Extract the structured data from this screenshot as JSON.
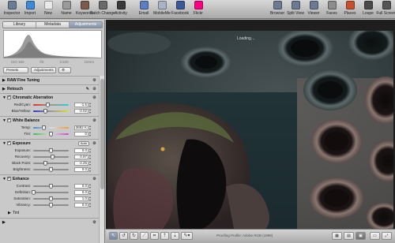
{
  "toolbar": {
    "left": [
      {
        "label": "Inspector",
        "icon": "inspector-icon",
        "color": "#6b7d96"
      },
      {
        "label": "Import",
        "icon": "import-icon",
        "color": "#3e8ad6"
      },
      {
        "label": "New",
        "icon": "new-icon",
        "color": "#e9e9e9"
      },
      {
        "label": "Name",
        "icon": "name-icon",
        "color": "#9a9a9a"
      },
      {
        "label": "Keywords",
        "icon": "keywords-icon",
        "color": "#7d5c4e"
      },
      {
        "label": "Batch Change",
        "icon": "batch-change-icon",
        "color": "#6a6a6a"
      },
      {
        "label": "Activity",
        "icon": "activity-icon",
        "color": "#3a3a3a"
      }
    ],
    "share": [
      {
        "label": "Email",
        "icon": "email-icon",
        "color": "#5b7ec0"
      },
      {
        "label": "MobileMe",
        "icon": "mobileme-icon",
        "color": "#a8b3c3"
      },
      {
        "label": "Facebook",
        "icon": "facebook-icon",
        "color": "#3b5998"
      },
      {
        "label": "Flickr",
        "icon": "flickr-icon",
        "color": "#ff0084"
      }
    ],
    "right": [
      {
        "label": "Browser",
        "icon": "browser-icon",
        "color": "#6b7b94"
      },
      {
        "label": "Split View",
        "icon": "split-view-icon",
        "color": "#6b7b94"
      },
      {
        "label": "Viewer",
        "icon": "viewer-icon",
        "color": "#6b7b94"
      },
      {
        "label": "Faces",
        "icon": "faces-icon",
        "color": "#8c8c8c"
      },
      {
        "label": "Places",
        "icon": "places-icon",
        "color": "#c7502f"
      },
      {
        "label": "Loupe",
        "icon": "loupe-icon",
        "color": "#4a4a4a"
      },
      {
        "label": "Full Screen",
        "icon": "full-screen-icon",
        "color": "#555555"
      }
    ]
  },
  "inspector": {
    "tabs": [
      "Library",
      "Metadata",
      "Adjustments"
    ],
    "active_tab": "Adjustments",
    "exif": [
      "ISO 160",
      "f/8",
      "1/100",
      "10mm"
    ],
    "presets_label": "Presets",
    "adjustments_label": "Adjustments"
  },
  "sections": {
    "raw": "RAW Fine Tuning",
    "retouch": "Retouch",
    "chroma": "Chromatic Aberration",
    "wb": "White Balance",
    "exposure": "Exposure",
    "exposure_auto": "Auto",
    "enhance": "Enhance",
    "tint": "Tint"
  },
  "chroma": {
    "red_cyan": {
      "label": "Red/Cyan:",
      "value": "-1.5",
      "level": 0.4
    },
    "blue_yellow": {
      "label": "Blue/Yellow:",
      "value": "-2.02",
      "level": 0.35
    }
  },
  "wb": {
    "temp": {
      "label": "Temp:",
      "value": "3682 K",
      "level": 0.3
    },
    "tint": {
      "label": "Tint:",
      "value": "0",
      "level": 0.5
    }
  },
  "exposure": {
    "exposure": {
      "label": "Exposure:",
      "value": "0.0",
      "level": 0.5
    },
    "recovery": {
      "label": "Recovery:",
      "value": "0.97",
      "level": 0.55
    },
    "black_point": {
      "label": "Black Point:",
      "value": "-2.25",
      "level": 0.35
    },
    "brightness": {
      "label": "Brightness:",
      "value": "0.0",
      "level": 0.5
    }
  },
  "enhance": {
    "contrast": {
      "label": "Contrast:",
      "value": "0.0",
      "level": 0.5
    },
    "definition": {
      "label": "Definition:",
      "value": "0.0",
      "level": 0.0
    },
    "saturation": {
      "label": "Saturation:",
      "value": "1.0",
      "level": 0.5
    },
    "vibrancy": {
      "label": "Vibrancy:",
      "value": "0.0",
      "level": 0.5
    }
  },
  "viewer": {
    "loading": "Loading…",
    "proofing": "Proofing Profile: Adobe RGB (1998)"
  }
}
